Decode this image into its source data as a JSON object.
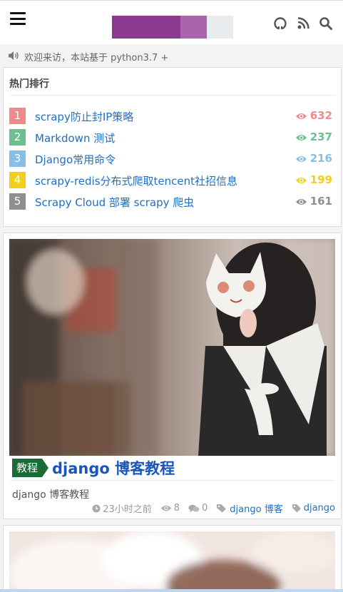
{
  "header": {
    "menu_icon": "hamburger-icon",
    "logo_colors": [
      "#8b3a8f",
      "#a865ac",
      "#e7ebee"
    ],
    "icons": [
      "github-icon",
      "rss-icon",
      "search-icon"
    ]
  },
  "notice": {
    "icon": "speaker-icon",
    "text": "欢迎来访，本站基于 python3.7 +"
  },
  "hot": {
    "title": "热门排行",
    "items": [
      {
        "rank": "1",
        "title": "scrapy防止封IP策略",
        "views": "632",
        "color": "#f08a8a"
      },
      {
        "rank": "2",
        "title": "Markdown 测试",
        "views": "237",
        "color": "#6cc08f"
      },
      {
        "rank": "3",
        "title": "Django常用命令",
        "views": "216",
        "color": "#86c0ea"
      },
      {
        "rank": "4",
        "title": "scrapy-redis分布式爬取tencent社招信息",
        "views": "199",
        "color": "#f4cf1a"
      },
      {
        "rank": "5",
        "title": "Scrapy Cloud 部署 scrapy 爬虫",
        "views": "161",
        "color": "#8f8f8f"
      }
    ]
  },
  "post": {
    "category": "教程",
    "title": "django 博客教程",
    "excerpt": "django 博客教程",
    "time": "23小时之前",
    "views": "8",
    "comments": "0",
    "tags": [
      "django 博客",
      "django"
    ],
    "category_color": "#1a6b35"
  }
}
